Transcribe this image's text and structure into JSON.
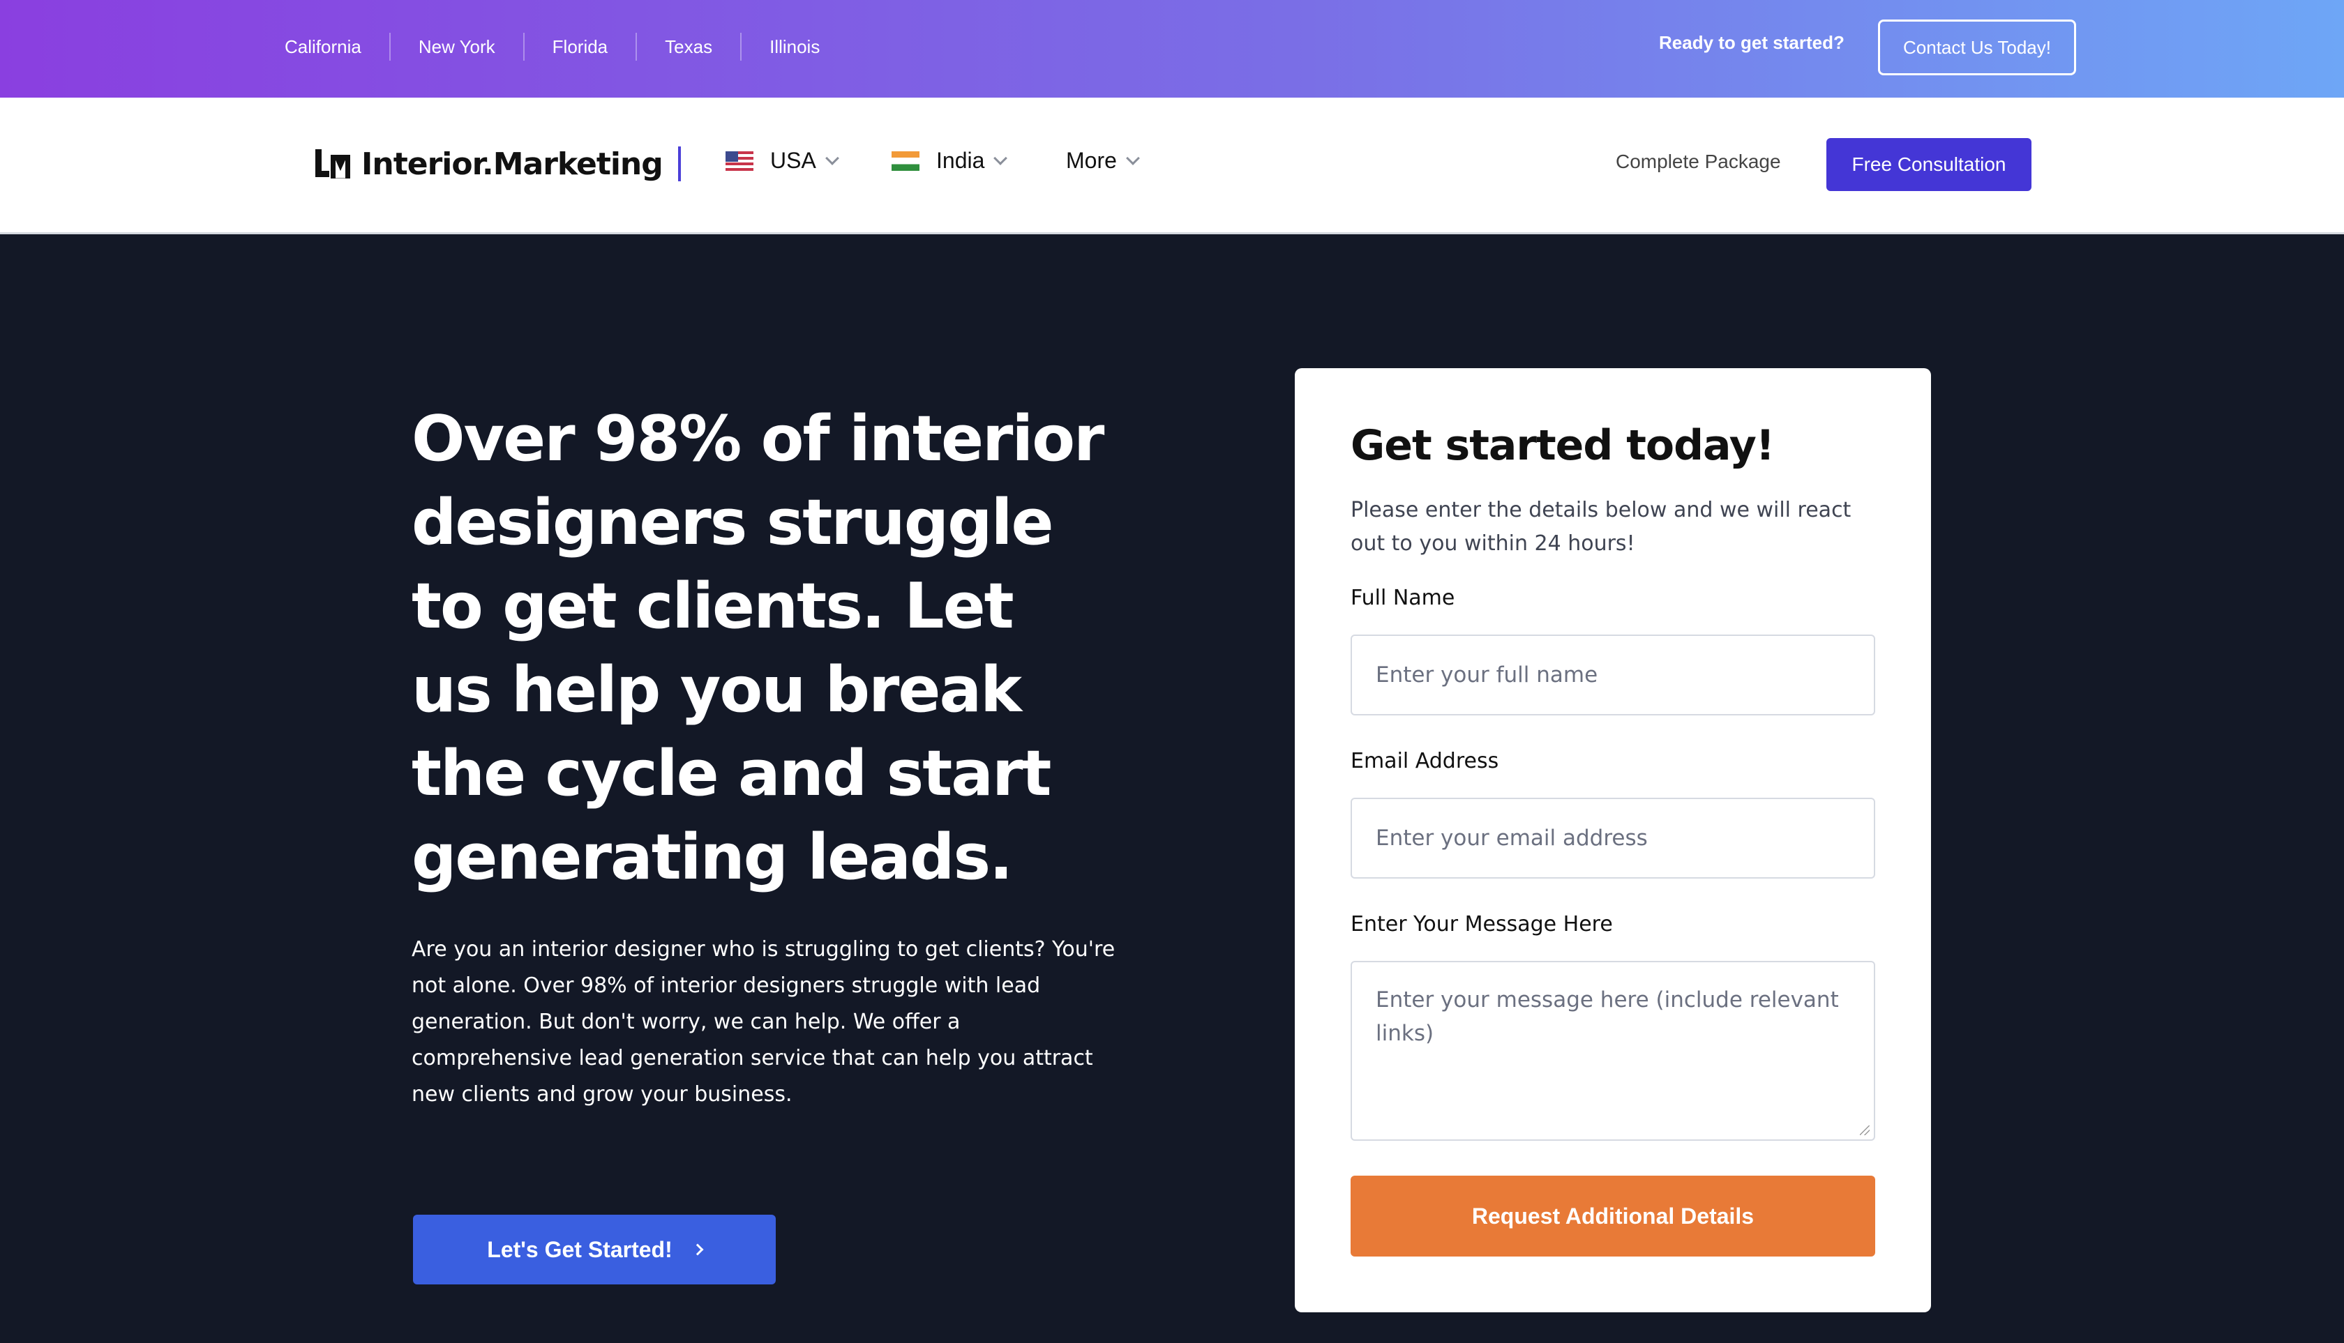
{
  "topbar": {
    "states": [
      "California",
      "New York",
      "Florida",
      "Texas",
      "Illinois"
    ],
    "ready_text": "Ready to get started?",
    "contact_label": "Contact Us Today!"
  },
  "nav": {
    "logo_text": "Interior.Marketing",
    "usa_label": "USA",
    "india_label": "India",
    "more_label": "More",
    "complete_label": "Complete Package",
    "consult_label": "Free Consultation"
  },
  "hero": {
    "headline": "Over 98% of interior designers struggle to get clients. Let us help you break the cycle and start generating leads.",
    "paragraph": "Are you an interior designer who is struggling to get clients? You're not alone. Over 98% of interior designers struggle with lead generation. But don't worry, we can help. We offer a comprehensive lead generation service that can help you attract new clients and grow your business.",
    "cta_label": "Let's Get Started!"
  },
  "form": {
    "title": "Get started today!",
    "subtitle": "Please enter the details below and we will react out to you within 24 hours!",
    "name_label": "Full Name",
    "name_placeholder": "Enter your full name",
    "email_label": "Email Address",
    "email_placeholder": "Enter your email address",
    "message_label": "Enter Your Message Here",
    "message_placeholder": "Enter your message here (include relevant links)",
    "submit_label": "Request Additional Details"
  },
  "colors": {
    "gradient_start": "#8a3fe0",
    "gradient_end": "#6ea6f6",
    "hero_bg": "#131826",
    "primary": "#4436d6",
    "cta": "#3a5fe0",
    "submit": "#e87a37"
  }
}
